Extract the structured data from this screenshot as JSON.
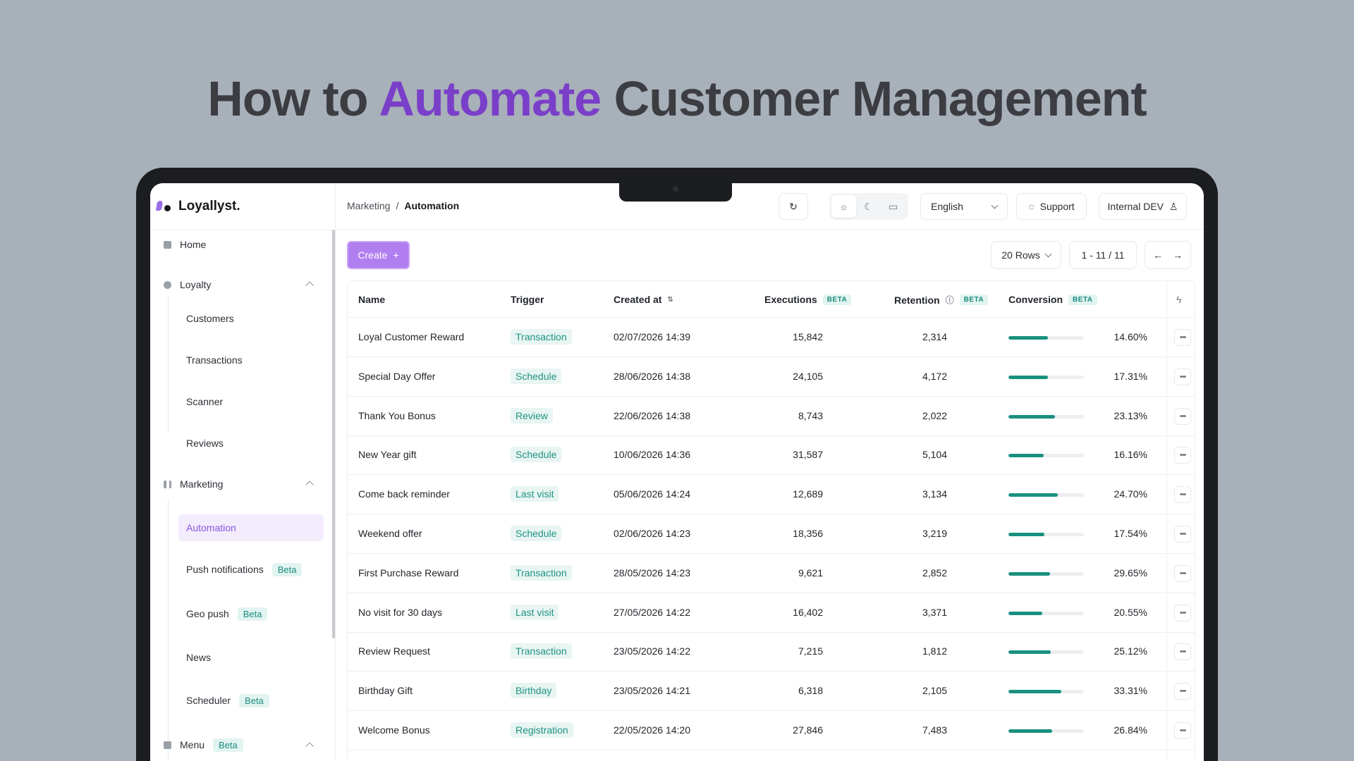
{
  "headline": {
    "pre": "How to ",
    "accent": "Automate",
    "post": " Customer Management"
  },
  "colors": {
    "accent": "#7a3fc9",
    "brand": "#9b6ee6",
    "teal": "#19907f",
    "create_button": "#b17ef0"
  },
  "brand": {
    "name": "Loyallyst."
  },
  "topbar": {
    "breadcrumb": [
      "Marketing",
      "/",
      "Automation"
    ],
    "refresh_icon": "refresh-icon",
    "theme_icons": [
      "sun-icon",
      "moon-icon",
      "monitor-icon"
    ],
    "language": "English",
    "support": "Support",
    "account": "Internal DEV"
  },
  "sidebar": {
    "home": "Home",
    "loyalty": {
      "label": "Loyalty",
      "items": [
        "Customers",
        "Transactions",
        "Scanner",
        "Reviews"
      ]
    },
    "marketing": {
      "label": "Marketing",
      "items": [
        {
          "label": "Automation",
          "active": true
        },
        {
          "label": "Push notifications",
          "badge": "Beta"
        },
        {
          "label": "Geo push",
          "badge": "Beta"
        },
        {
          "label": "News"
        },
        {
          "label": "Scheduler",
          "badge": "Beta"
        }
      ]
    },
    "menu": {
      "label": "Menu",
      "badge": "Beta"
    }
  },
  "toolbar": {
    "create": "Create",
    "create_icon": "+",
    "rows": "20 Rows",
    "pagination": "1 - 11 / 11",
    "prev": "←",
    "next": "→"
  },
  "table": {
    "headers": {
      "name": "Name",
      "trigger": "Trigger",
      "created_at": "Created at",
      "executions": "Executions",
      "retention": "Retention",
      "conversion": "Conversion",
      "beta": "BETA"
    },
    "rows": [
      {
        "name": "Loyal Customer Reward",
        "trigger": "Transaction",
        "created": "02/07/2026 14:39",
        "executions": "15,842",
        "retention": "2,314",
        "conversion": "14.60%",
        "bar": 0.52
      },
      {
        "name": "Special Day Offer",
        "trigger": "Schedule",
        "created": "28/06/2026 14:38",
        "executions": "24,105",
        "retention": "4,172",
        "conversion": "17.31%",
        "bar": 0.52
      },
      {
        "name": "Thank You Bonus",
        "trigger": "Review",
        "created": "22/06/2026 14:38",
        "executions": "8,743",
        "retention": "2,022",
        "conversion": "23.13%",
        "bar": 0.62
      },
      {
        "name": "New Year gift",
        "trigger": "Schedule",
        "created": "10/06/2026 14:36",
        "executions": "31,587",
        "retention": "5,104",
        "conversion": "16.16%",
        "bar": 0.47
      },
      {
        "name": "Come back reminder",
        "trigger": "Last visit",
        "created": "05/06/2026 14:24",
        "executions": "12,689",
        "retention": "3,134",
        "conversion": "24.70%",
        "bar": 0.65
      },
      {
        "name": "Weekend offer",
        "trigger": "Schedule",
        "created": "02/06/2026 14:23",
        "executions": "18,356",
        "retention": "3,219",
        "conversion": "17.54%",
        "bar": 0.48
      },
      {
        "name": "First Purchase Reward",
        "trigger": "Transaction",
        "created": "28/05/2026 14:23",
        "executions": "9,621",
        "retention": "2,852",
        "conversion": "29.65%",
        "bar": 0.55
      },
      {
        "name": "No visit for 30 days",
        "trigger": "Last visit",
        "created": "27/05/2026 14:22",
        "executions": "16,402",
        "retention": "3,371",
        "conversion": "20.55%",
        "bar": 0.45
      },
      {
        "name": "Review Request",
        "trigger": "Transaction",
        "created": "23/05/2026 14:22",
        "executions": "7,215",
        "retention": "1,812",
        "conversion": "25.12%",
        "bar": 0.56
      },
      {
        "name": "Birthday Gift",
        "trigger": "Birthday",
        "created": "23/05/2026 14:21",
        "executions": "6,318",
        "retention": "2,105",
        "conversion": "33.31%",
        "bar": 0.7
      },
      {
        "name": "Welcome Bonus",
        "trigger": "Registration",
        "created": "22/05/2026 14:20",
        "executions": "27,846",
        "retention": "7,483",
        "conversion": "26.84%",
        "bar": 0.58
      }
    ]
  }
}
